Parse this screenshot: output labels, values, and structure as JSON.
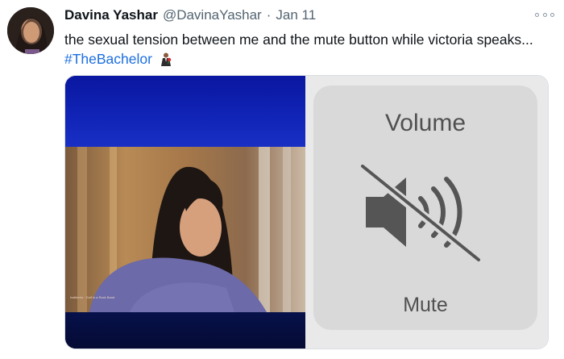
{
  "tweet": {
    "author_name": "Davina Yashar",
    "author_handle": "@DavinaYashar",
    "separator": "·",
    "date": "Jan 11",
    "text_main": "the sexual tension between me and the mute button while victoria speaks...",
    "hashtag": "#TheBachelor",
    "hashtag_color": "#1d6fe0",
    "emoji_icon": "bachelor-rose-emoji"
  },
  "media": {
    "tv_caption": "Ivaliberio · Golf in a Rock Band",
    "volume_hud": {
      "title": "Volume",
      "status": "Mute",
      "icon": "speaker-muted-icon"
    }
  }
}
